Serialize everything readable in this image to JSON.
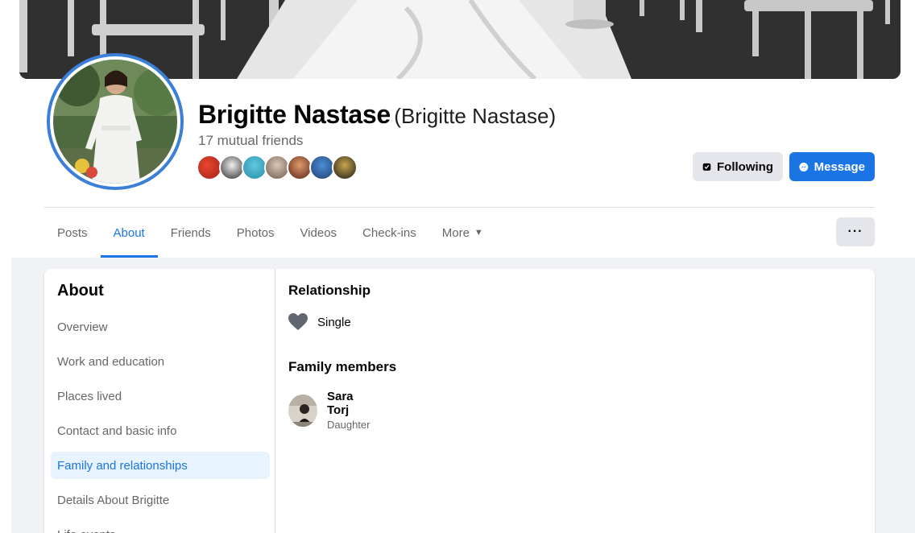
{
  "profile": {
    "name": "Brigitte Nastase",
    "alternate_name": "(Brigitte Nastase)",
    "mutual_friends": "17 mutual friends"
  },
  "actions": {
    "following_label": "Following",
    "message_label": "Message",
    "more_dots": "···"
  },
  "tabs": [
    {
      "label": "Posts"
    },
    {
      "label": "About"
    },
    {
      "label": "Friends"
    },
    {
      "label": "Photos"
    },
    {
      "label": "Videos"
    },
    {
      "label": "Check-ins"
    },
    {
      "label": "More"
    }
  ],
  "sidebar": {
    "title": "About",
    "items": [
      {
        "label": "Overview"
      },
      {
        "label": "Work and education"
      },
      {
        "label": "Places lived"
      },
      {
        "label": "Contact and basic info"
      },
      {
        "label": "Family and relationships"
      },
      {
        "label": "Details About Brigitte"
      },
      {
        "label": "Life events"
      }
    ]
  },
  "content": {
    "relationship_title": "Relationship",
    "relationship_status": "Single",
    "family_title": "Family members",
    "members": [
      {
        "name": "Sara Torj",
        "role": "Daughter"
      }
    ]
  },
  "colors": {
    "accent": "#1b74e4",
    "active_bg": "#e7f3ff",
    "avatar_ring": "#3b7fd8"
  }
}
